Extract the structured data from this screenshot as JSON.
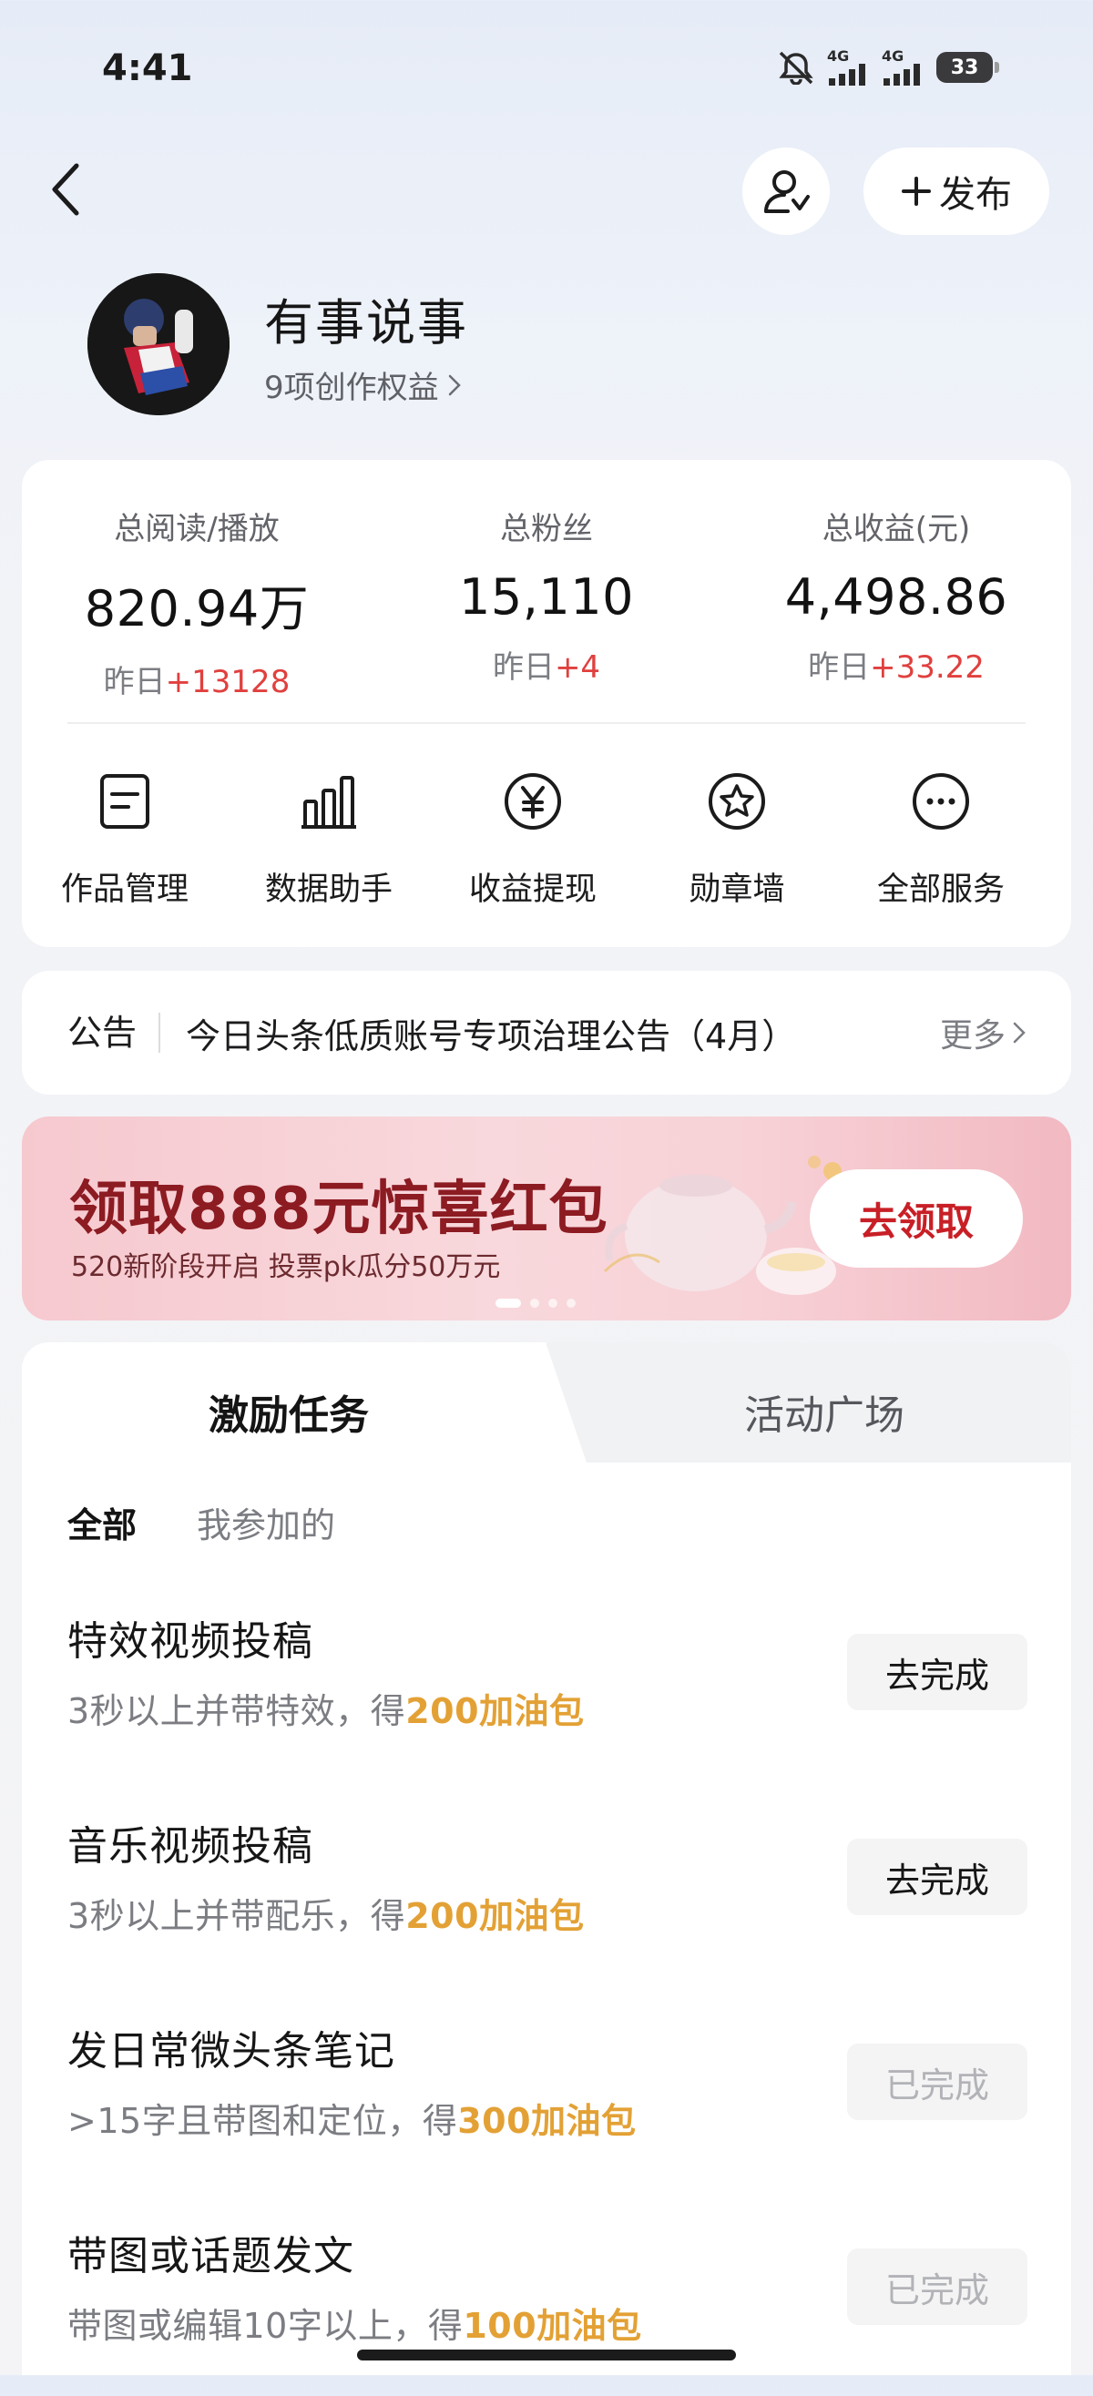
{
  "status_bar": {
    "time": "4:41",
    "network_1": "4G",
    "network_2": "4G",
    "battery": "33"
  },
  "top_bar": {
    "publish_label": "发布"
  },
  "profile": {
    "name": "有事说事",
    "rights": "9项创作权益"
  },
  "stats": [
    {
      "label": "总阅读/播放",
      "value": "820.94万",
      "delta_prefix": "昨日",
      "delta": "+13128"
    },
    {
      "label": "总粉丝",
      "value": "15,110",
      "delta_prefix": "昨日",
      "delta": "+4"
    },
    {
      "label": "总收益(元)",
      "value": "4,498.86",
      "delta_prefix": "昨日",
      "delta": "+33.22"
    }
  ],
  "tools": [
    {
      "label": "作品管理",
      "icon": "document-icon"
    },
    {
      "label": "数据助手",
      "icon": "bar-chart-icon"
    },
    {
      "label": "收益提现",
      "icon": "yuan-icon"
    },
    {
      "label": "勋章墙",
      "icon": "badge-icon"
    },
    {
      "label": "全部服务",
      "icon": "more-icon"
    }
  ],
  "notice": {
    "tag": "公告",
    "text": "今日头条低质账号专项治理公告（4月）",
    "more": "更多"
  },
  "banner": {
    "title": "领取888元惊喜红包",
    "subtitle": "520新阶段开启 投票pk瓜分50万元",
    "cta": "去领取",
    "active_slide": 1,
    "slide_count": 4
  },
  "task_tabs": [
    "激励任务",
    "活动广场"
  ],
  "filters": [
    "全部",
    "我参加的"
  ],
  "tasks": [
    {
      "name": "特效视频投稿",
      "desc_prefix": "3秒以上并带特效，得",
      "reward": "200加油包",
      "button": "去完成",
      "done": false
    },
    {
      "name": "音乐视频投稿",
      "desc_prefix": "3秒以上并带配乐，得",
      "reward": "200加油包",
      "button": "去完成",
      "done": false
    },
    {
      "name": "发日常微头条笔记",
      "desc_prefix": ">15字且带图和定位，得",
      "reward": "300加油包",
      "button": "已完成",
      "done": true
    },
    {
      "name": "带图或话题发文",
      "desc_prefix": "带图或编辑10字以上，得",
      "reward": "100加油包",
      "button": "已完成",
      "done": true
    }
  ],
  "colors": {
    "accent_red": "#e0403e",
    "reward_orange": "#e3a135",
    "banner_red": "#8c1b22"
  }
}
